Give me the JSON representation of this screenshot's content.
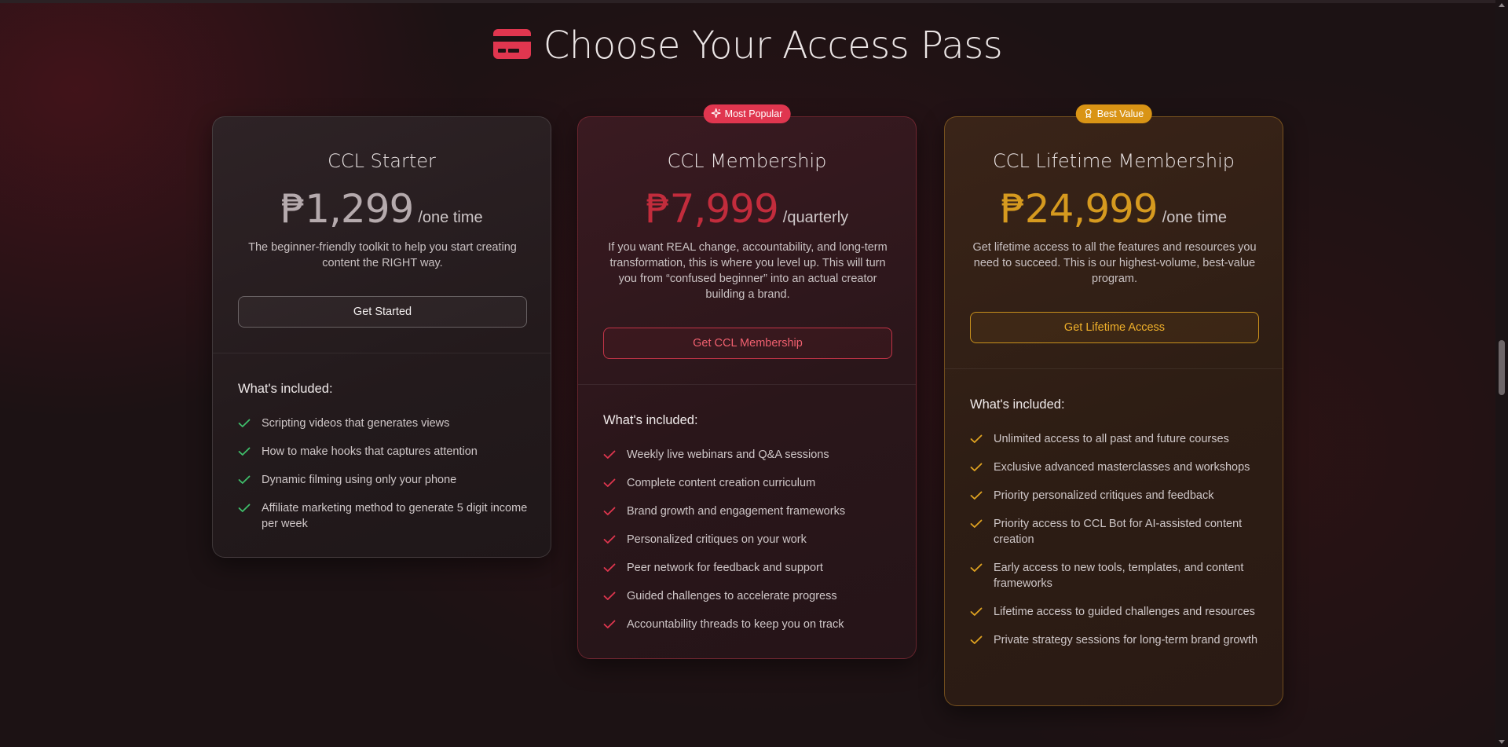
{
  "page": {
    "title": "Choose Your Access Pass",
    "title_icon": "credit-card-icon",
    "accent_color": "#e0364f"
  },
  "plans": [
    {
      "name": "CCL Starter",
      "price": "₱1,299",
      "period": "/one time",
      "description": "The beginner-friendly toolkit to help you start creating content the RIGHT way.",
      "cta": "Get Started",
      "included_title": "What's included:",
      "check_color": "#3fbf6b",
      "features": [
        "Scripting videos that generates views",
        "How to make hooks that captures attention",
        "Dynamic filming using only your phone",
        "Affiliate marketing method to generate 5 digit income per week"
      ]
    },
    {
      "badge": "Most Popular",
      "badge_icon": "sparkles-icon",
      "name": "CCL Membership",
      "price": "₱7,999",
      "period": "/quarterly",
      "description": "If you want REAL change, accountability, and long-term transformation, this is where you level up. This will turn you from “confused beginner” into an actual creator building a brand.",
      "cta": "Get CCL Membership",
      "included_title": "What's included:",
      "check_color": "#e0364f",
      "features": [
        "Weekly live webinars and Q&A sessions",
        "Complete content creation curriculum",
        "Brand growth and engagement frameworks",
        "Personalized critiques on your work",
        "Peer network for feedback and support",
        "Guided challenges to accelerate progress",
        "Accountability threads to keep you on track"
      ]
    },
    {
      "badge": "Best Value",
      "badge_icon": "award-icon",
      "name": "CCL Lifetime Membership",
      "price": "₱24,999",
      "period": "/one time",
      "description": "Get lifetime access to all the features and resources you need to succeed. This is our highest-volume, best-value program.",
      "cta": "Get Lifetime Access",
      "included_title": "What's included:",
      "check_color": "#e0a321",
      "features": [
        "Unlimited access to all past and future courses",
        "Exclusive advanced masterclasses and workshops",
        "Priority personalized critiques and feedback",
        "Priority access to CCL Bot for AI-assisted content creation",
        "Early access to new tools, templates, and content frameworks",
        "Lifetime access to guided challenges and resources",
        "Private strategy sessions for long-term brand growth"
      ]
    }
  ]
}
